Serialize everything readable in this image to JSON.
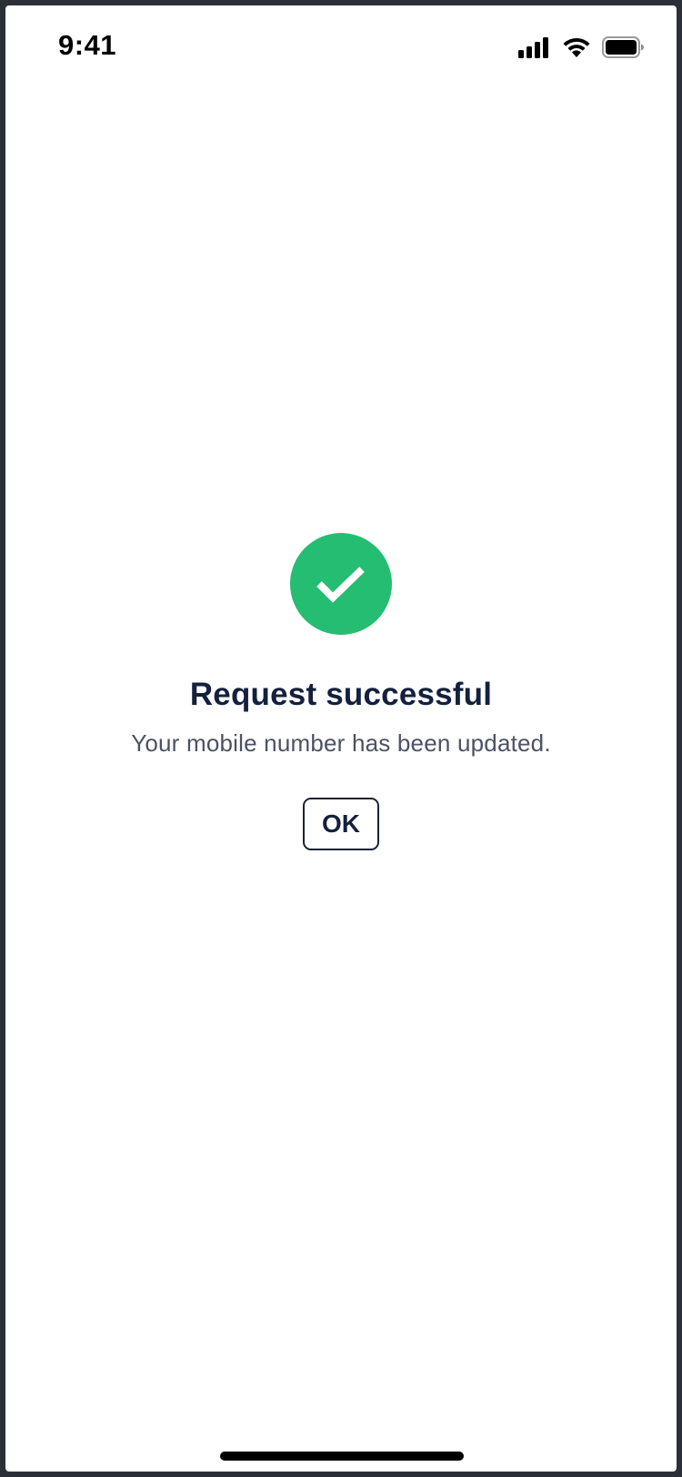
{
  "status_bar": {
    "time": "9:41",
    "icons": [
      "cellular-signal-icon",
      "wifi-icon",
      "battery-icon"
    ]
  },
  "result": {
    "icon": "checkmark-icon",
    "title": "Request successful",
    "message": "Your mobile number has been updated.",
    "ok_label": "OK"
  },
  "colors": {
    "success": "#25bd71",
    "title_text": "#14213d",
    "body_text": "#4b5263",
    "frame": "#2b3036"
  }
}
